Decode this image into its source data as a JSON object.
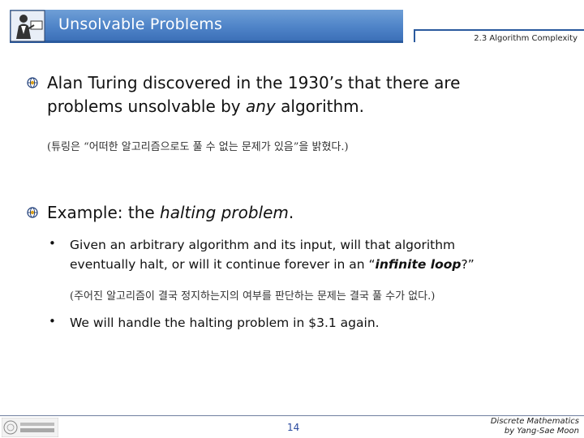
{
  "header": {
    "title": "Unsolvable Problems",
    "section": "2.3 Algorithm Complexity"
  },
  "bullets": [
    {
      "line1": "Alan Turing discovered in the 1930’s that there are",
      "line2_pre": "problems unsolvable by ",
      "line2_em": "any",
      "line2_post": " algorithm.",
      "korean": "(튜링은 “어떠한 알고리즘으로도 풀 수 없는 문제가 있음”을 밝혔다.)"
    },
    {
      "pre": "Example: the ",
      "em": "halting problem",
      "post": ".",
      "sub": [
        {
          "line1": "Given an arbitrary algorithm and its input, will that algorithm",
          "line2_pre": "eventually halt, or will it continue forever in an “",
          "line2_em": "infinite loop",
          "line2_post": "?”",
          "korean": "(주어진 알고리즘이 결국 정지하는지의 여부를 판단하는 문제는 결국 풀 수가 없다.)"
        },
        {
          "line1": "We will handle the halting problem in $3.1 again."
        }
      ]
    }
  ],
  "footer": {
    "page": "14",
    "credit_line1": "Discrete Mathematics",
    "credit_line2": "by Yang-Sae Moon",
    "logo_text": "강원대학교 컴퓨터과학과"
  },
  "colors": {
    "title_bar": "#4f84c8",
    "rule": "#2a5a9e",
    "page_number": "#2a4a9e"
  }
}
